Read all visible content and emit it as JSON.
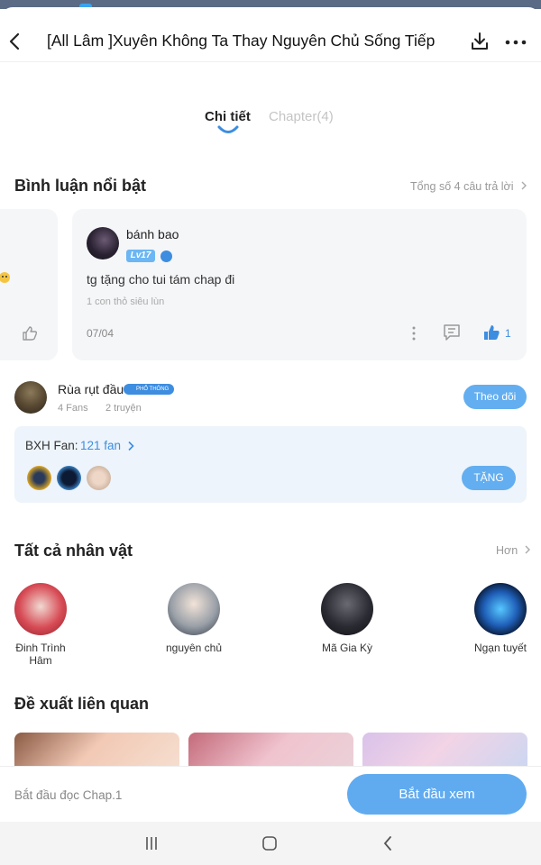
{
  "header": {
    "title": "[All Lâm ]Xuyên Không Ta Thay Nguyên Chủ Sống Tiếp",
    "icons": [
      "back-arrow-icon",
      "download-icon",
      "more-dots-icon"
    ]
  },
  "tabs": [
    {
      "label": "Chi tiết",
      "active": true
    },
    {
      "label": "Chapter(4)",
      "active": false
    }
  ],
  "comments": {
    "title": "Bình luận nổi bật",
    "total_label": "Tổng số 4 câu trả lời",
    "featured": {
      "username": "bánh bao",
      "level": "Lv17",
      "text": "tg tặng cho tui tám chap đi",
      "sub": "1 con thỏ siêu lùn",
      "date": "07/04",
      "likes": "1"
    }
  },
  "author": {
    "name": "Rùa rụt đầu",
    "badge": "PHỔ THÔNG",
    "fans": "4 Fans",
    "stories": "2 truyện",
    "follow_label": "Theo dõi"
  },
  "fan_board": {
    "label": "BXH Fan:",
    "count": "121 fan",
    "gift_label": "TẶNG"
  },
  "characters": {
    "title": "Tất cả nhân vật",
    "more_label": "Hơn",
    "items": [
      {
        "name": "Đinh Trình Hâm"
      },
      {
        "name": "nguyên chủ"
      },
      {
        "name": "Mã Gia Kỳ"
      },
      {
        "name": "Ngạn tuyết"
      }
    ]
  },
  "related": {
    "title": "Đề xuất liên quan"
  },
  "bottom": {
    "hint": "Bắt đầu đọc Chap.1",
    "read_label": "Bắt đầu xem"
  },
  "colors": {
    "accent": "#60abf0",
    "link": "#3d8de0",
    "card_bg": "#f5f6f8"
  }
}
